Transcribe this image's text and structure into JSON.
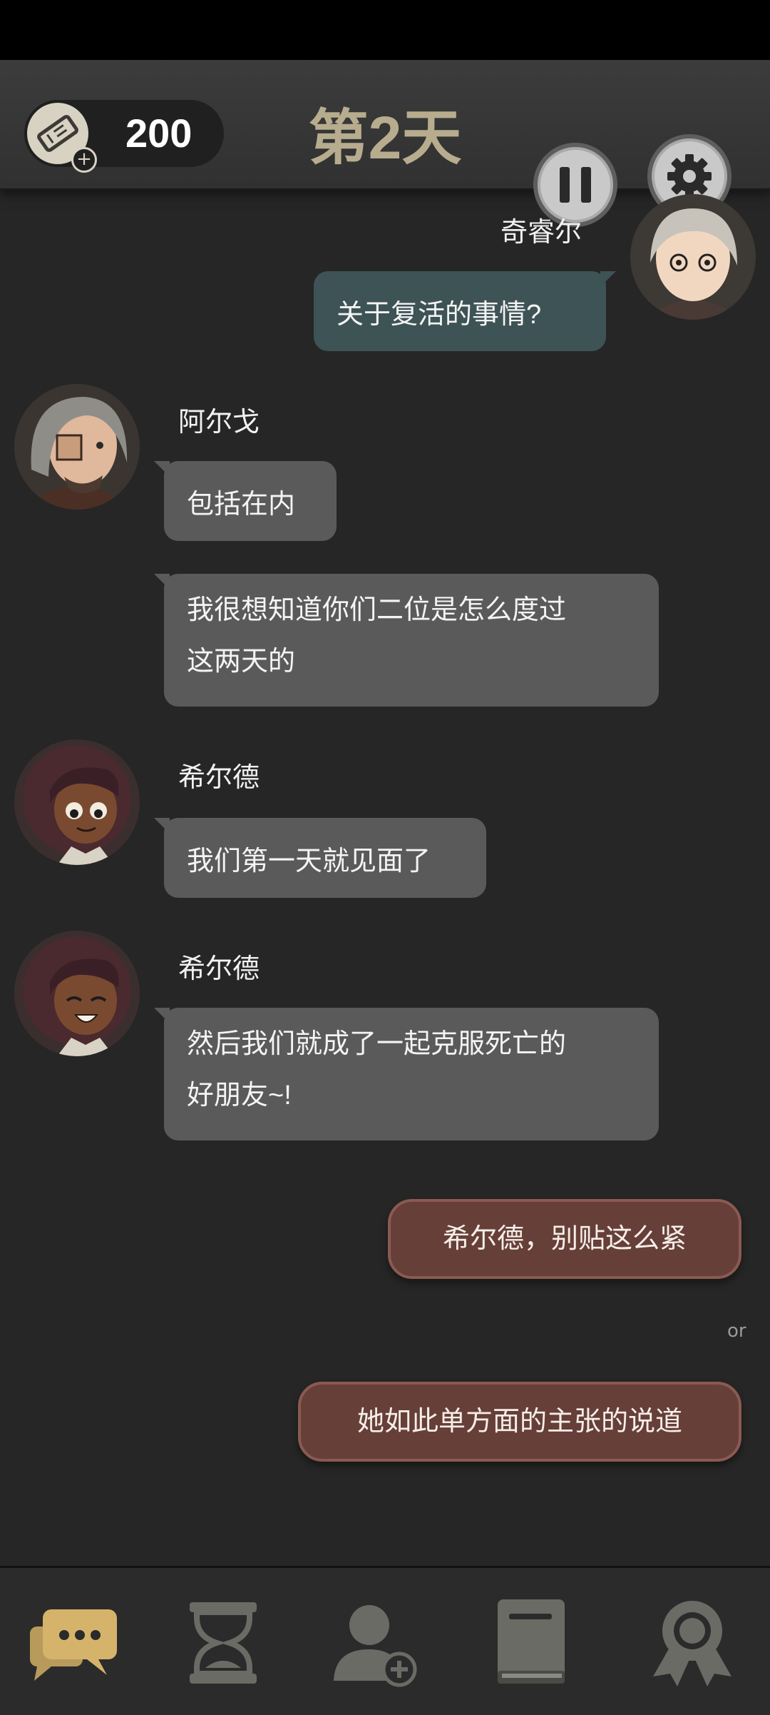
{
  "header": {
    "ticket_count": "200",
    "day_title": "第2天"
  },
  "messages": [
    {
      "sender": "奇睿尔",
      "text": "关于复活的事情?",
      "side": "right"
    },
    {
      "sender": "阿尔戈",
      "text": "包括在内",
      "side": "left"
    },
    {
      "sender": "",
      "text_line1": "我很想知道你们二位是怎么度过",
      "text_line2": "这两天的",
      "side": "left"
    },
    {
      "sender": "希尔德",
      "text": "我们第一天就见面了",
      "side": "left"
    },
    {
      "sender": "希尔德",
      "text_line1": "然后我们就成了一起克服死亡的",
      "text_line2": "好朋友~!",
      "side": "left"
    }
  ],
  "choices": {
    "option_1": "希尔德，别贴这么紧",
    "separator": "or",
    "option_2": "她如此单方面的主张的说道"
  },
  "nav": {
    "items": [
      "chat-icon",
      "hourglass-icon",
      "add-person-icon",
      "book-icon",
      "award-icon"
    ]
  },
  "colors": {
    "background": "#252625",
    "left_bubble": "#5a5a5a",
    "right_bubble": "#3e5356",
    "choice_bubble": "#663f38",
    "title_gold": "#b8ac8e",
    "nav_active": "#d6b36a",
    "nav_inactive": "#6b6b66"
  }
}
